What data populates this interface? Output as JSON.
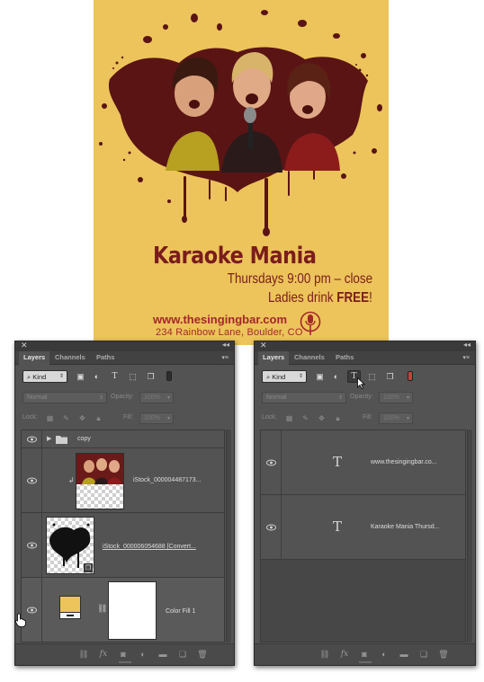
{
  "poster": {
    "title": "Karaoke Mania",
    "line1": "Thursdays 9:00 pm – close",
    "line2_prefix": "Ladies drink ",
    "line2_bold": "FREE",
    "line2_suffix": "!",
    "url": "www.thesingingbar.com",
    "address": "234 Rainbow Lane, Boulder, CO",
    "colors": {
      "background": "#ecc45b",
      "splash": "#5a1414",
      "text": "#7a1c1c",
      "accent": "#a4272a"
    }
  },
  "panels": [
    {
      "tabs": [
        "Layers",
        "Channels",
        "Paths"
      ],
      "filter": {
        "kind_label": "Kind"
      },
      "blend_mode": "Normal",
      "opacity_label": "Opacity:",
      "opacity_value": "100%",
      "lock_label": "Lock:",
      "fill_label": "Fill:",
      "fill_value": "100%",
      "layers": [
        {
          "name": "copy",
          "type": "group"
        },
        {
          "name": "iStock_000004487173...",
          "type": "image-clipped"
        },
        {
          "name": "iStock_000006054688 [Convert...",
          "type": "mask"
        },
        {
          "name": "Color Fill 1",
          "type": "fill",
          "swatch": "#ecc45b"
        }
      ]
    },
    {
      "tabs": [
        "Layers",
        "Channels",
        "Paths"
      ],
      "filter": {
        "kind_label": "Kind"
      },
      "blend_mode": "Normal",
      "opacity_label": "Opacity:",
      "opacity_value": "100%",
      "lock_label": "Lock:",
      "fill_label": "Fill:",
      "fill_value": "100%",
      "layers": [
        {
          "name": "www.thesingingbar.co...",
          "type": "text"
        },
        {
          "name": "Karaoke Mania Thursd...",
          "type": "text"
        }
      ]
    }
  ],
  "icons": {
    "filter": [
      "search-icon",
      "image-filter-icon",
      "adjustment-filter-icon",
      "type-filter-icon",
      "shape-filter-icon",
      "smart-object-filter-icon"
    ],
    "lock": [
      "lock-transparent-icon",
      "lock-image-icon",
      "lock-position-icon",
      "lock-all-icon"
    ],
    "bottom": [
      "link-layers-icon",
      "fx-icon",
      "add-mask-icon",
      "adjustment-layer-icon",
      "new-group-icon",
      "new-layer-icon",
      "trash-icon"
    ]
  }
}
